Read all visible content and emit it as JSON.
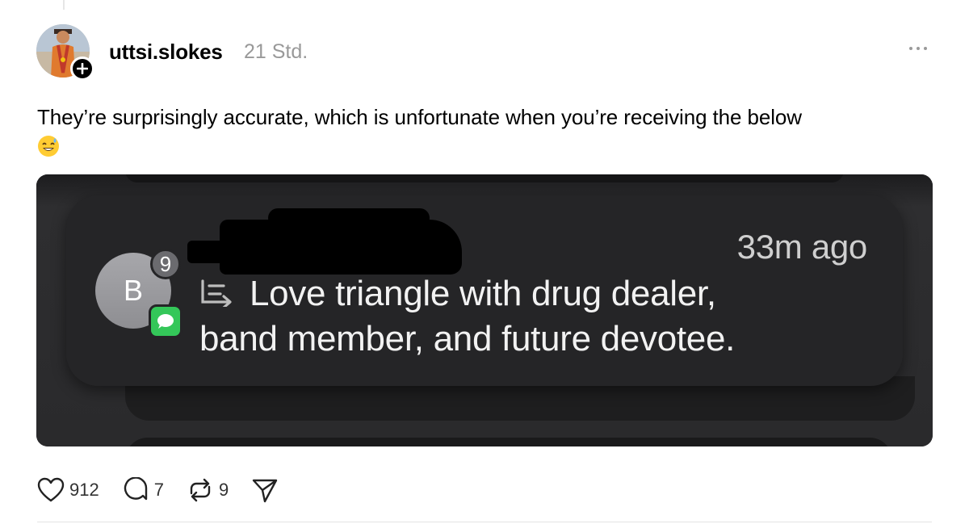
{
  "post": {
    "username": "uttsi.slokes",
    "timestamp": "21 Std.",
    "text": "They’re surprisingly accurate, which is unfortunate when you’re receiving the below",
    "emoji": "😅"
  },
  "notification": {
    "time": "33m ago",
    "avatar_initial": "B",
    "unread_count": "9",
    "message_line1": "Love triangle with drug dealer,",
    "message_line2": "band member, and future devotee."
  },
  "actions": {
    "likes": "912",
    "replies": "7",
    "reposts": "9"
  },
  "icons": {
    "follow": "plus-icon",
    "more": "more-icon",
    "like": "heart-icon",
    "reply": "comment-icon",
    "repost": "repost-icon",
    "share": "send-icon",
    "messages_app": "messages-icon",
    "reply_indicator": "reply-icon"
  },
  "colors": {
    "messages_green": "#34c759",
    "timestamp_gray": "#999999",
    "notification_bg": "#252527"
  }
}
